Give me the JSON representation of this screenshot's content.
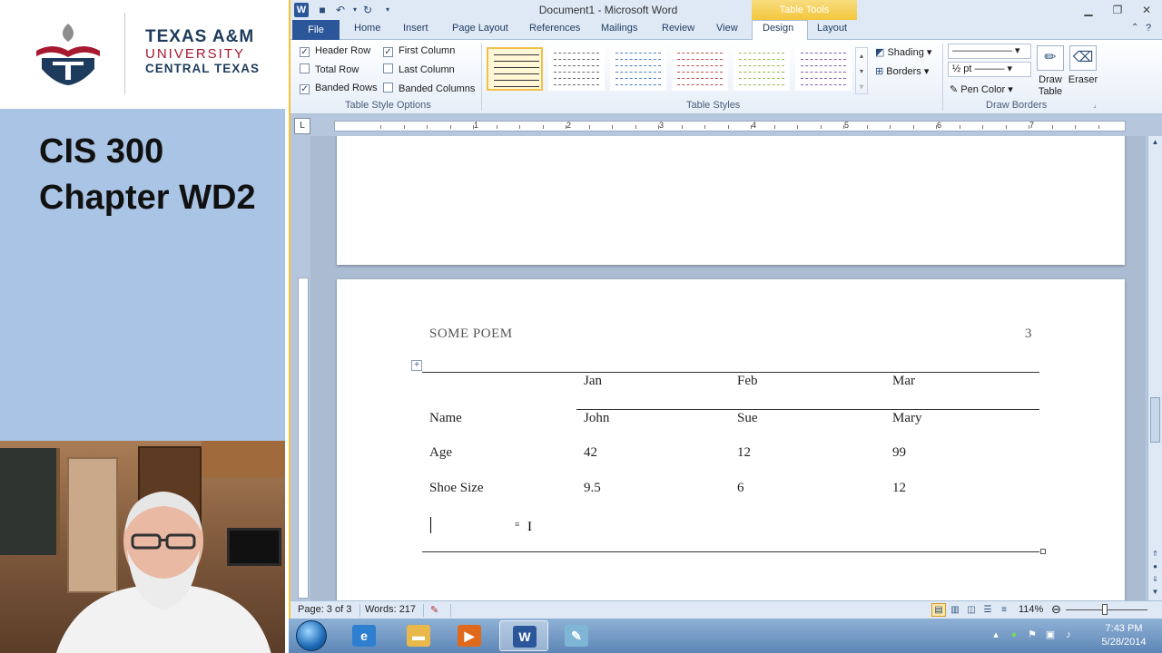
{
  "slide": {
    "logo_line1": "TEXAS A&M",
    "logo_line2": "UNIVERSITY",
    "logo_line3": "CENTRAL TEXAS",
    "title_line1": "CIS 300",
    "title_line2": "Chapter WD2"
  },
  "word": {
    "window_title": "Document1  -  Microsoft Word",
    "contextual_tab": "Table Tools",
    "tabs": [
      "File",
      "Home",
      "Insert",
      "Page Layout",
      "References",
      "Mailings",
      "Review",
      "View",
      "Design",
      "Layout"
    ],
    "active_tab": "Design",
    "table_style_options": {
      "header_row": {
        "label": "Header Row",
        "checked": true
      },
      "first_column": {
        "label": "First Column",
        "checked": true
      },
      "total_row": {
        "label": "Total Row",
        "checked": false
      },
      "last_column": {
        "label": "Last Column",
        "checked": false
      },
      "banded_rows": {
        "label": "Banded Rows",
        "checked": true
      },
      "banded_columns": {
        "label": "Banded Columns",
        "checked": false
      },
      "group_label": "Table Style Options"
    },
    "table_styles": {
      "group_label": "Table Styles",
      "thumb_colors": [
        "#333333",
        "#6b6b6b",
        "#4f81bd",
        "#c0504d",
        "#9bbb59",
        "#8064a2"
      ],
      "shading_label": "Shading",
      "borders_label": "Borders"
    },
    "draw_borders": {
      "group_label": "Draw Borders",
      "pen_weight": "½ pt",
      "pen_color_label": "Pen Color",
      "draw_table_label_1": "Draw",
      "draw_table_label_2": "Table",
      "eraser_label": "Eraser"
    },
    "ruler_numbers": [
      "1",
      "2",
      "3",
      "4",
      "5",
      "6",
      "7"
    ],
    "document": {
      "header_title": "SOME POEM",
      "page_number": "3",
      "table_header": [
        "",
        "Jan",
        "Feb",
        "Mar"
      ],
      "table_rows": [
        [
          "Name",
          "John",
          "Sue",
          "Mary"
        ],
        [
          "Age",
          "42",
          "12",
          "99"
        ],
        [
          "Shoe Size",
          "9.5",
          "6",
          "12"
        ]
      ]
    },
    "status": {
      "page": "Page: 3 of 3",
      "words": "Words: 217",
      "zoom": "114%"
    }
  },
  "taskbar": {
    "time": "7:43 PM",
    "date": "5/28/2014",
    "apps": [
      "internet-explorer",
      "file-explorer",
      "media-player",
      "word",
      "notepad"
    ]
  }
}
